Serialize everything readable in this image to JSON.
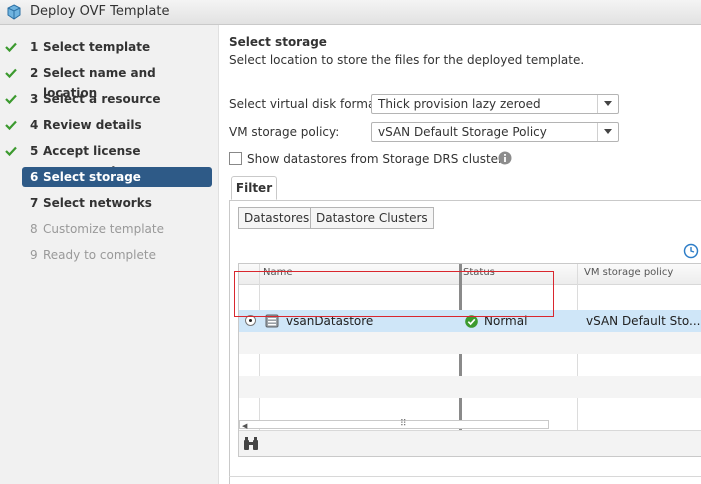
{
  "window": {
    "title": "Deploy OVF Template",
    "icon": "vsphere-package-icon"
  },
  "steps": [
    {
      "num": "1",
      "label": "Select template",
      "state": "done"
    },
    {
      "num": "2",
      "label": "Select name and location",
      "state": "done"
    },
    {
      "num": "3",
      "label": "Select a resource",
      "state": "done"
    },
    {
      "num": "4",
      "label": "Review details",
      "state": "done"
    },
    {
      "num": "5",
      "label": "Accept license agreements",
      "state": "done"
    },
    {
      "num": "6",
      "label": "Select storage",
      "state": "active"
    },
    {
      "num": "7",
      "label": "Select networks",
      "state": "next"
    },
    {
      "num": "8",
      "label": "Customize template",
      "state": "pending"
    },
    {
      "num": "9",
      "label": "Ready to complete",
      "state": "pending"
    }
  ],
  "page": {
    "title": "Select storage",
    "subtitle": "Select location to store the files for the deployed template."
  },
  "form": {
    "disk_format_label": "Select virtual disk format:",
    "disk_format_value": "Thick provision lazy zeroed",
    "policy_label": "VM storage policy:",
    "policy_value": "vSAN Default Storage Policy",
    "sdrs_checkbox_label": "Show datastores from Storage DRS clusters",
    "sdrs_checked": false
  },
  "tabs": {
    "filter": "Filter"
  },
  "segments": {
    "datastores": "Datastores",
    "clusters": "Datastore Clusters"
  },
  "grid": {
    "columns": {
      "name": "Name",
      "status": "Status",
      "policy": "VM storage policy"
    },
    "rows": [
      {
        "name": "vsanDatastore",
        "status": "Normal",
        "policy": "vSAN Default Sto...",
        "selected": true
      }
    ]
  },
  "colors": {
    "accent": "#2e5a87",
    "check": "#3c9a2f",
    "highlight": "#d9272e",
    "row_selected": "#cfe6f8"
  }
}
